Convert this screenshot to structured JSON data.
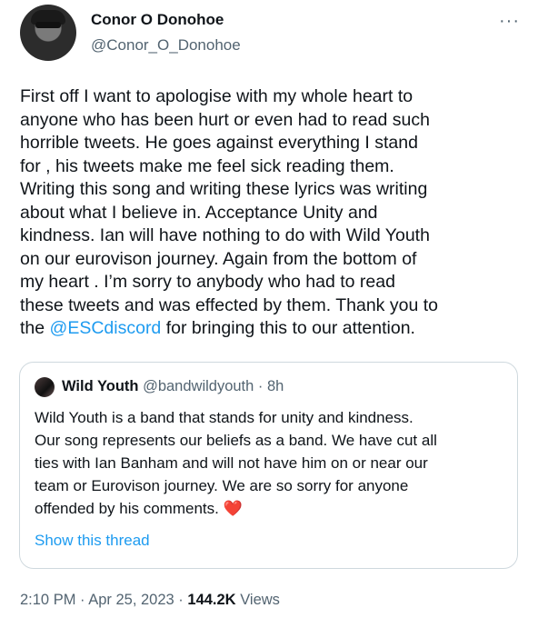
{
  "author": {
    "display_name": "Conor O Donohoe",
    "handle": "@Conor_O_Donohoe"
  },
  "more_icon": "···",
  "tweet": {
    "text_before_mention": "First off I want to apologise with my whole heart to\nanyone who has been hurt or even had to read such\nhorrible tweets. He goes against everything I stand\nfor , his tweets make me feel sick reading them.\nWriting this song and writing these lyrics was writing\nabout what I believe in. Acceptance Unity and\nkindness. Ian will have nothing to do with Wild Youth\non our eurovison journey. Again from the bottom of\nmy heart . I’m sorry to anybody  who had to read\nthese tweets and was effected by them. Thank you to\nthe ",
    "mention": "@ESCdiscord",
    "text_after_mention": " for bringing this to our attention."
  },
  "quoted_tweet": {
    "display_name": "Wild Youth",
    "handle": "@bandwildyouth",
    "separator": " · ",
    "time_ago": "8h",
    "text": "Wild Youth is a band that stands for unity and kindness.\nOur song represents our beliefs as a band. We have cut all\nties with Ian Banham and will not have him on or near our\nteam or Eurovison journey. We are so sorry for anyone\noffended by his comments. ",
    "heart_emoji": "❤️",
    "show_thread_label": "Show this thread"
  },
  "footer": {
    "time": "2:10 PM",
    "date": "Apr 25, 2023",
    "separator": " · ",
    "views_count": "144.2K",
    "views_label": " Views"
  }
}
